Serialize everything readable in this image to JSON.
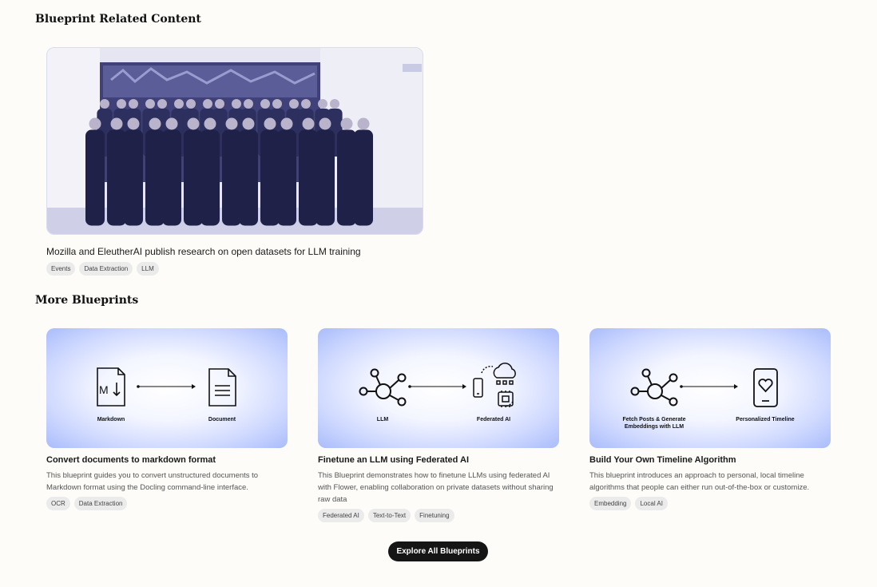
{
  "related": {
    "section_title": "Blueprint Related Content",
    "card": {
      "title": "Mozilla and EleutherAI publish research on open datasets for LLM training",
      "tags": [
        "Events",
        "Data Extraction",
        "LLM"
      ]
    }
  },
  "more": {
    "section_title": "More Blueprints",
    "cards": [
      {
        "title": "Convert documents to markdown format",
        "description": "This blueprint guides you to convert unstructured documents to Markdown format using the Docling command-line interface.",
        "tags": [
          "OCR",
          "Data Extraction"
        ],
        "diagram": {
          "left_label": "Markdown",
          "right_label": "Document",
          "left_icon": "markdown-file-icon",
          "right_icon": "document-icon"
        }
      },
      {
        "title": "Finetune an LLM using Federated AI",
        "description": "This Blueprint demonstrates how to finetune LLMs using federated AI with Flower, enabling collaboration on private datasets without sharing raw data",
        "tags": [
          "Federated AI",
          "Text-to-Text",
          "Finetuning"
        ],
        "diagram": {
          "left_label": "LLM",
          "right_label": "Federated AI",
          "left_icon": "network-icon",
          "right_icon": "federated-icon"
        }
      },
      {
        "title": "Build Your Own Timeline Algorithm",
        "description": "This blueprint introduces an approach to personal, local timeline algorithms that people can either run out-of-the-box or customize.",
        "tags": [
          "Embedding",
          "Local AI"
        ],
        "diagram": {
          "left_label_line1": "Fetch Posts & Generate",
          "left_label_line2": "Embeddings with LLM",
          "right_label": "Personalized Timeline",
          "left_icon": "network-icon",
          "right_icon": "phone-heart-icon"
        }
      }
    ]
  },
  "cta": {
    "label": "Explore All Blueprints"
  },
  "colors": {
    "background": "#fdfcf8",
    "button": "#151515",
    "thumb_gradient_edge": "#a9bcfb",
    "photo_tint": "#c7c8e6"
  }
}
